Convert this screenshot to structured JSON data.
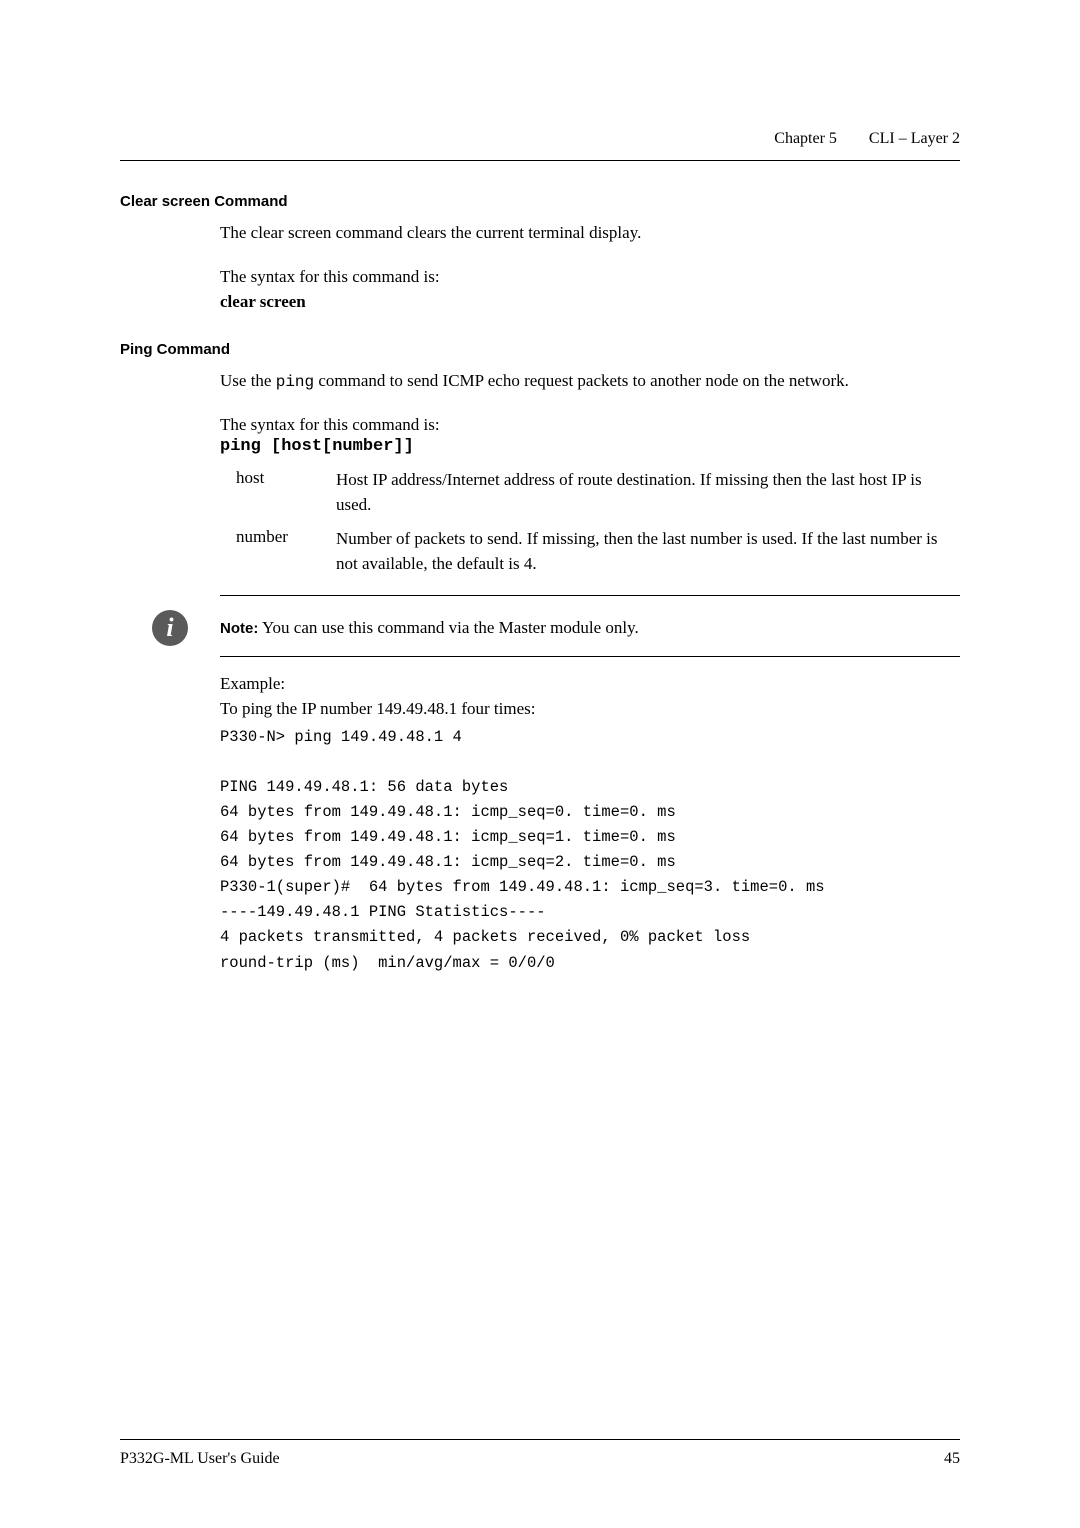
{
  "header": {
    "chapter": "Chapter 5",
    "title": "CLI – Layer 2"
  },
  "sections": {
    "clearScreen": {
      "heading": "Clear screen Command",
      "desc": "The clear screen command clears the current terminal display.",
      "syntaxIntro": "The syntax for this command is:",
      "syntax": "clear screen"
    },
    "ping": {
      "heading": "Ping Command",
      "desc1_pre": "Use the ",
      "desc1_cmd": "ping",
      "desc1_post": " command to send ICMP echo request packets to another node on the network.",
      "syntaxIntro": "The syntax for this command is:",
      "syntax": "ping [host[number]]",
      "params": [
        {
          "name": "host",
          "desc": "Host IP address/Internet address of route destination. If missing then the last host IP is used."
        },
        {
          "name": "number",
          "desc": "Number of packets to send. If missing, then the last number is used. If the last number is not available, the default is 4."
        }
      ],
      "note": {
        "label": "Note:",
        "text": "  You can use this command via the Master module only."
      },
      "example": {
        "label": "Example:",
        "intro": "To ping the IP number 149.49.48.1 four times:",
        "code": "P330-N> ping 149.49.48.1 4\n\nPING 149.49.48.1: 56 data bytes\n64 bytes from 149.49.48.1: icmp_seq=0. time=0. ms\n64 bytes from 149.49.48.1: icmp_seq=1. time=0. ms\n64 bytes from 149.49.48.1: icmp_seq=2. time=0. ms\nP330-1(super)#  64 bytes from 149.49.48.1: icmp_seq=3. time=0. ms\n----149.49.48.1 PING Statistics----\n4 packets transmitted, 4 packets received, 0% packet loss\nround-trip (ms)  min/avg/max = 0/0/0"
      }
    }
  },
  "footer": {
    "left": "P332G-ML User's Guide",
    "right": "45"
  }
}
